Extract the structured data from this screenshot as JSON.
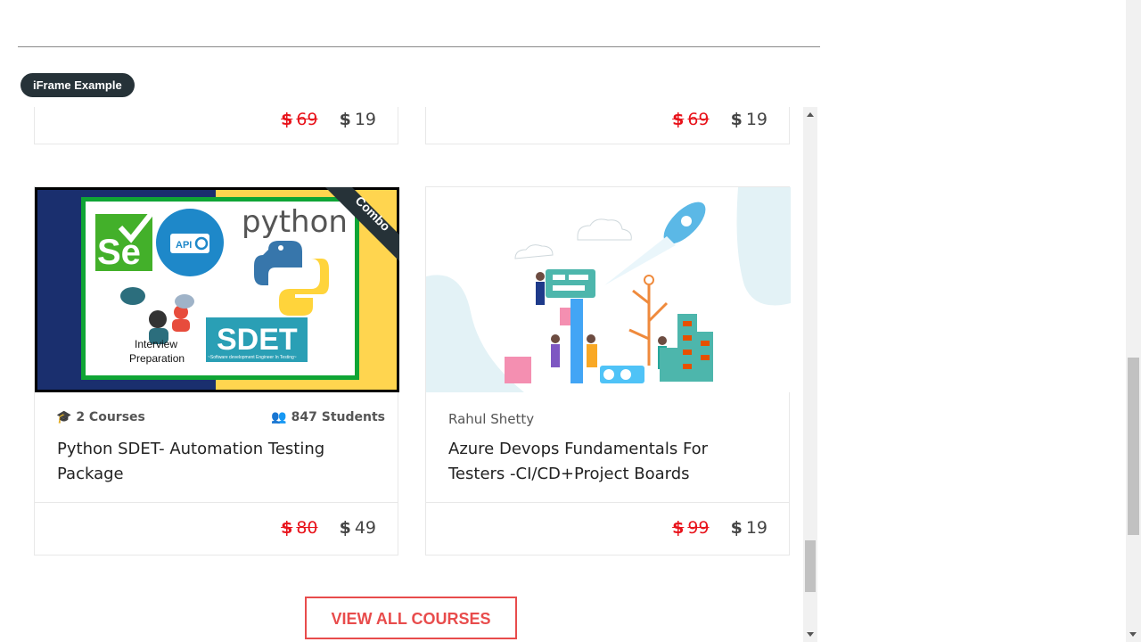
{
  "badge": {
    "label": "iFrame Example"
  },
  "top_cards": [
    {
      "old_price": "69",
      "new_price": "19"
    },
    {
      "old_price": "69",
      "new_price": "19"
    }
  ],
  "cards": [
    {
      "courses": "2 Courses",
      "students": "847 Students",
      "title_line1": "Python SDET- Automation Testing",
      "title_line2": "Package",
      "old_price": "80",
      "new_price": "49",
      "image": {
        "ribbon": "Combo",
        "python_text": "python",
        "sdet_text": "SDET",
        "sdet_sub": "~Software development Engineer In Testing~",
        "interview_line1": "Interview",
        "interview_line2": "Preparation",
        "api_text": "API",
        "se_text": "Se"
      }
    },
    {
      "author": "Rahul Shetty",
      "title_line1": "Azure Devops Fundamentals For",
      "title_line2": "Testers -CI/CD+Project Boards",
      "old_price": "99",
      "new_price": "19"
    }
  ],
  "currency": "$",
  "view_all": "VIEW ALL COURSES",
  "colors": {
    "old_price": "#e8131b",
    "accent": "#e84c4c",
    "badge_bg": "#263238"
  }
}
